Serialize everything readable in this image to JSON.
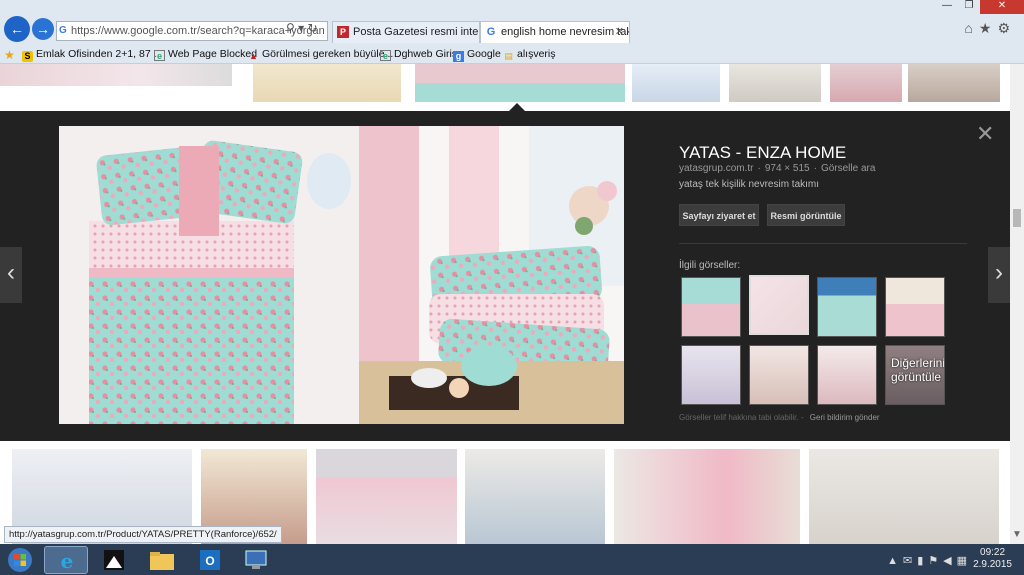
{
  "browser": {
    "address_url": "https://www.google.com.tr/search?q=karaca+yorgan",
    "tabs": [
      {
        "label": "Posta Gazetesi resmi internet si..."
      },
      {
        "label": "english home nevresim tak..."
      }
    ],
    "favorites": [
      {
        "label": "Emlak Ofisinden 2+1, 87 ..."
      },
      {
        "label": "Web Page Blocked"
      },
      {
        "label": "Görülmesi gereken büyüle..."
      },
      {
        "label": "Dghweb Giriş"
      },
      {
        "label": "Google"
      },
      {
        "label": "alışveriş"
      }
    ]
  },
  "detail": {
    "title": "YATAS - ENZA HOME",
    "source_domain": "yatasgrup.com.tr",
    "dimensions": "974 × 515",
    "search_by_image": "Görselle ara",
    "description": "yataş tek kişilik nevresim takımı",
    "visit_button": "Sayfayı ziyaret et",
    "view_button": "Resmi görüntüle",
    "related_heading": "İlgili görseller:",
    "more_label": "Diğerlerini görüntüle",
    "footer_text": "Görseller telif hakkına tabi olabilir.",
    "footer_feedback": "Geri bildirim gönder"
  },
  "status_url": "http://yatasgrup.com.tr/Product/YATAS/PRETTY(Ranforce)/652/",
  "clock": {
    "time": "09:22",
    "date": "2.9.2015"
  }
}
